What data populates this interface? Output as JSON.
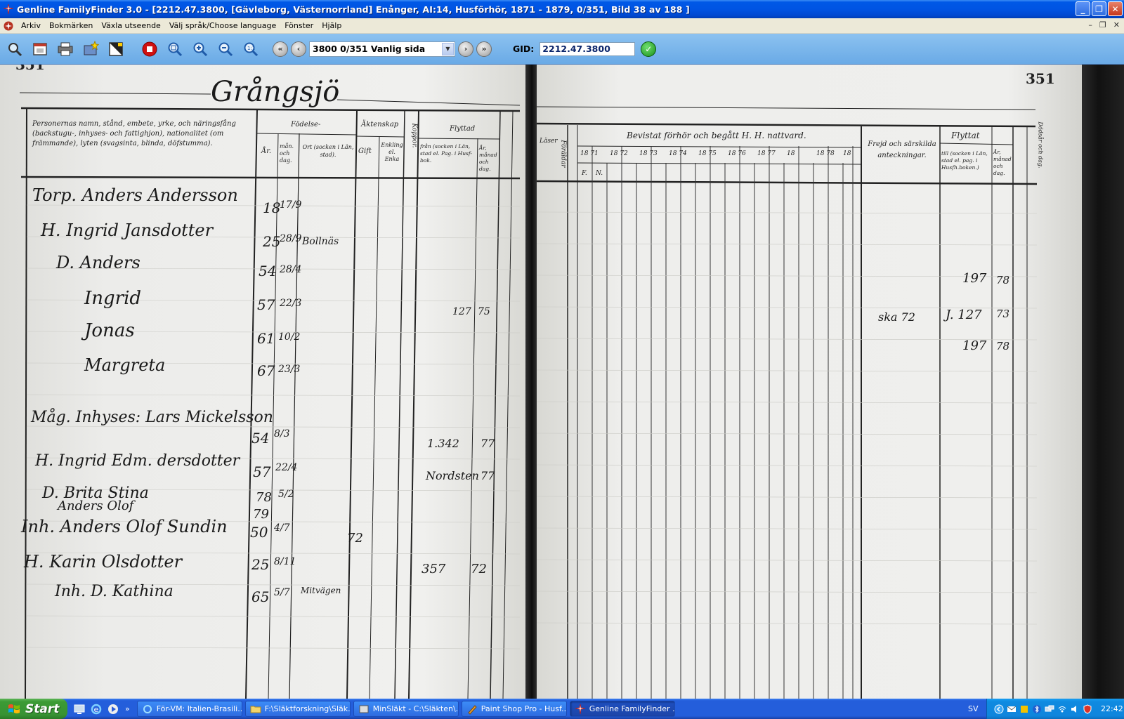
{
  "window": {
    "title": "Genline FamilyFinder 3.0 - [2212.47.3800,  [Gävleborg, Västernorrland]  Enånger,  AI:14, Husförhör,  1871 - 1879, 0/351,  Bild 38 av 188   ]"
  },
  "menu": {
    "items": [
      "Arkiv",
      "Bokmärken",
      "Växla utseende",
      "Välj språk/Choose language",
      "Fönster",
      "Hjälp"
    ]
  },
  "toolbar": {
    "page_select_value": "3800   0/351   Vanlig sida",
    "gid_label": "GID:",
    "gid_value": "2212.47.3800"
  },
  "document": {
    "left_page_number_fragment": "351",
    "right_page_number": "351",
    "place_heading": "Grångsjö",
    "left_header": {
      "col1": "Personernas namn, stånd, embete, yrke, och näringsfång (backstugu-, inhyses- och fattighjon), nationalitet (om främmande), lyten (svagsinta, blinda, döfstumma).",
      "birth": "Födelse-",
      "year": "År.",
      "month_day": "mån. och dag.",
      "place": "Ort (socken i Län, stad).",
      "marriage": "Äktenskap",
      "married": "Gift",
      "widowed": "Enkling el. Enka",
      "vaccine": "Koppor.",
      "moved": "Flyttad",
      "from": "från (socken i Län, stad el. Pag. i Husf-bok.",
      "year_month_day": "År, månad och dag."
    },
    "right_header": {
      "reading": "Läser",
      "parents": "Föräldar",
      "exam": "Bevistat förhör och begått H. H. nattvard.",
      "years": [
        "18 71",
        "18 72",
        "18 73",
        "18 74",
        "18 75",
        "18 76",
        "18 77",
        "18",
        "18 78",
        "18"
      ],
      "fn": [
        "F.",
        "N."
      ],
      "conduct": "Frejd och särskilda anteckningar.",
      "moved": "Flyttat",
      "to": "till (socken i Län, stad el. pag. i Husfh.boken.)",
      "year_day": "År, månad och dag.",
      "death": "Dödsår och dag."
    },
    "entries": [
      {
        "name": "Torp. Anders Andersson",
        "year": "18",
        "date": "17/9"
      },
      {
        "name": "H. Ingrid Jansdotter",
        "year": "25",
        "date": "28/9",
        "place": "Bollnäs"
      },
      {
        "name": "D. Anders",
        "year": "54",
        "date": "28/4"
      },
      {
        "name": "Ingrid",
        "year": "57",
        "date": "22/3",
        "moved_from": "127",
        "moved_year": "75"
      },
      {
        "name": "Jonas",
        "year": "61",
        "date": "10/2"
      },
      {
        "name": "Margreta",
        "year": "67",
        "date": "23/3"
      },
      {
        "name": "Måg. Inhyses: Lars Mickelsson",
        "year": "54",
        "date": "8/3",
        "moved_from": "1.342",
        "moved_year": "77"
      },
      {
        "name": "H. Ingrid Edm. dersdotter",
        "year": "57",
        "date": "22/4",
        "moved_from": "Nordsten",
        "moved_year": "77"
      },
      {
        "name": "D. Brita Stina",
        "year": "78",
        "date": "5/2"
      },
      {
        "name": "Anders Olof",
        "year": "79",
        "date": ""
      },
      {
        "name": "Inh. Anders Olof Sundin",
        "year": "50",
        "date": "4/7",
        "married": "72"
      },
      {
        "name": "H. Karin Olsdotter",
        "year": "25",
        "date": "8/11",
        "moved_from": "357",
        "moved_year": "72"
      },
      {
        "name": "Inh. D. Kathina",
        "year": "65",
        "date": "5/7",
        "place": "Mitvägen"
      }
    ],
    "notes": [
      "ska 72",
      "J. 127",
      "197",
      "197",
      "78",
      "73",
      "78"
    ]
  },
  "taskbar": {
    "start_label": "Start",
    "more": "»",
    "tasks": [
      "För-VM: Italien-Brasili...",
      "F:\\Släktforskning\\Släk...",
      "MinSläkt - C:\\Släkten\\...",
      "Paint Shop Pro - Husf...",
      "Genline FamilyFinder ..."
    ],
    "language": "SV",
    "clock": "22:42"
  },
  "colors": {
    "titlebar": "#0054e3",
    "toolbar": "#7ab6ec",
    "taskbar": "#245edb",
    "start": "#3c9b35",
    "go_button": "#1b8f1b",
    "stop_button": "#d01010"
  }
}
